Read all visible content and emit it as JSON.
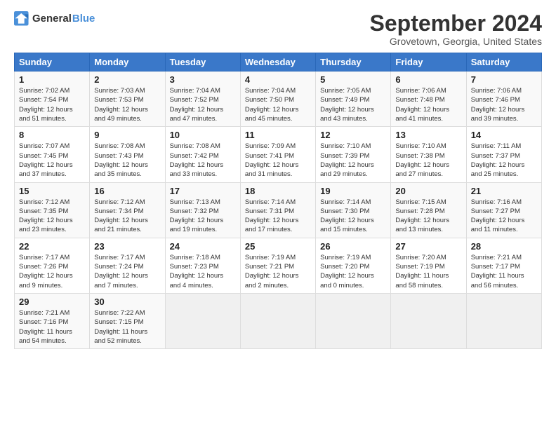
{
  "header": {
    "logo": {
      "general": "General",
      "blue": "Blue"
    },
    "title": "September 2024",
    "subtitle": "Grovetown, Georgia, United States"
  },
  "calendar": {
    "days_of_week": [
      "Sunday",
      "Monday",
      "Tuesday",
      "Wednesday",
      "Thursday",
      "Friday",
      "Saturday"
    ],
    "weeks": [
      [
        null,
        {
          "day": 2,
          "sunrise": "7:03 AM",
          "sunset": "7:53 PM",
          "daylight": "12 hours and 49 minutes."
        },
        {
          "day": 3,
          "sunrise": "7:04 AM",
          "sunset": "7:52 PM",
          "daylight": "12 hours and 47 minutes."
        },
        {
          "day": 4,
          "sunrise": "7:04 AM",
          "sunset": "7:50 PM",
          "daylight": "12 hours and 45 minutes."
        },
        {
          "day": 5,
          "sunrise": "7:05 AM",
          "sunset": "7:49 PM",
          "daylight": "12 hours and 43 minutes."
        },
        {
          "day": 6,
          "sunrise": "7:06 AM",
          "sunset": "7:48 PM",
          "daylight": "12 hours and 41 minutes."
        },
        {
          "day": 7,
          "sunrise": "7:06 AM",
          "sunset": "7:46 PM",
          "daylight": "12 hours and 39 minutes."
        }
      ],
      [
        {
          "day": 1,
          "sunrise": "7:02 AM",
          "sunset": "7:54 PM",
          "daylight": "12 hours and 51 minutes."
        },
        null,
        null,
        null,
        null,
        null,
        null
      ],
      [
        {
          "day": 8,
          "sunrise": "7:07 AM",
          "sunset": "7:45 PM",
          "daylight": "12 hours and 37 minutes."
        },
        {
          "day": 9,
          "sunrise": "7:08 AM",
          "sunset": "7:43 PM",
          "daylight": "12 hours and 35 minutes."
        },
        {
          "day": 10,
          "sunrise": "7:08 AM",
          "sunset": "7:42 PM",
          "daylight": "12 hours and 33 minutes."
        },
        {
          "day": 11,
          "sunrise": "7:09 AM",
          "sunset": "7:41 PM",
          "daylight": "12 hours and 31 minutes."
        },
        {
          "day": 12,
          "sunrise": "7:10 AM",
          "sunset": "7:39 PM",
          "daylight": "12 hours and 29 minutes."
        },
        {
          "day": 13,
          "sunrise": "7:10 AM",
          "sunset": "7:38 PM",
          "daylight": "12 hours and 27 minutes."
        },
        {
          "day": 14,
          "sunrise": "7:11 AM",
          "sunset": "7:37 PM",
          "daylight": "12 hours and 25 minutes."
        }
      ],
      [
        {
          "day": 15,
          "sunrise": "7:12 AM",
          "sunset": "7:35 PM",
          "daylight": "12 hours and 23 minutes."
        },
        {
          "day": 16,
          "sunrise": "7:12 AM",
          "sunset": "7:34 PM",
          "daylight": "12 hours and 21 minutes."
        },
        {
          "day": 17,
          "sunrise": "7:13 AM",
          "sunset": "7:32 PM",
          "daylight": "12 hours and 19 minutes."
        },
        {
          "day": 18,
          "sunrise": "7:14 AM",
          "sunset": "7:31 PM",
          "daylight": "12 hours and 17 minutes."
        },
        {
          "day": 19,
          "sunrise": "7:14 AM",
          "sunset": "7:30 PM",
          "daylight": "12 hours and 15 minutes."
        },
        {
          "day": 20,
          "sunrise": "7:15 AM",
          "sunset": "7:28 PM",
          "daylight": "12 hours and 13 minutes."
        },
        {
          "day": 21,
          "sunrise": "7:16 AM",
          "sunset": "7:27 PM",
          "daylight": "12 hours and 11 minutes."
        }
      ],
      [
        {
          "day": 22,
          "sunrise": "7:17 AM",
          "sunset": "7:26 PM",
          "daylight": "12 hours and 9 minutes."
        },
        {
          "day": 23,
          "sunrise": "7:17 AM",
          "sunset": "7:24 PM",
          "daylight": "12 hours and 7 minutes."
        },
        {
          "day": 24,
          "sunrise": "7:18 AM",
          "sunset": "7:23 PM",
          "daylight": "12 hours and 4 minutes."
        },
        {
          "day": 25,
          "sunrise": "7:19 AM",
          "sunset": "7:21 PM",
          "daylight": "12 hours and 2 minutes."
        },
        {
          "day": 26,
          "sunrise": "7:19 AM",
          "sunset": "7:20 PM",
          "daylight": "12 hours and 0 minutes."
        },
        {
          "day": 27,
          "sunrise": "7:20 AM",
          "sunset": "7:19 PM",
          "daylight": "11 hours and 58 minutes."
        },
        {
          "day": 28,
          "sunrise": "7:21 AM",
          "sunset": "7:17 PM",
          "daylight": "11 hours and 56 minutes."
        }
      ],
      [
        {
          "day": 29,
          "sunrise": "7:21 AM",
          "sunset": "7:16 PM",
          "daylight": "11 hours and 54 minutes."
        },
        {
          "day": 30,
          "sunrise": "7:22 AM",
          "sunset": "7:15 PM",
          "daylight": "11 hours and 52 minutes."
        },
        null,
        null,
        null,
        null,
        null
      ]
    ]
  }
}
